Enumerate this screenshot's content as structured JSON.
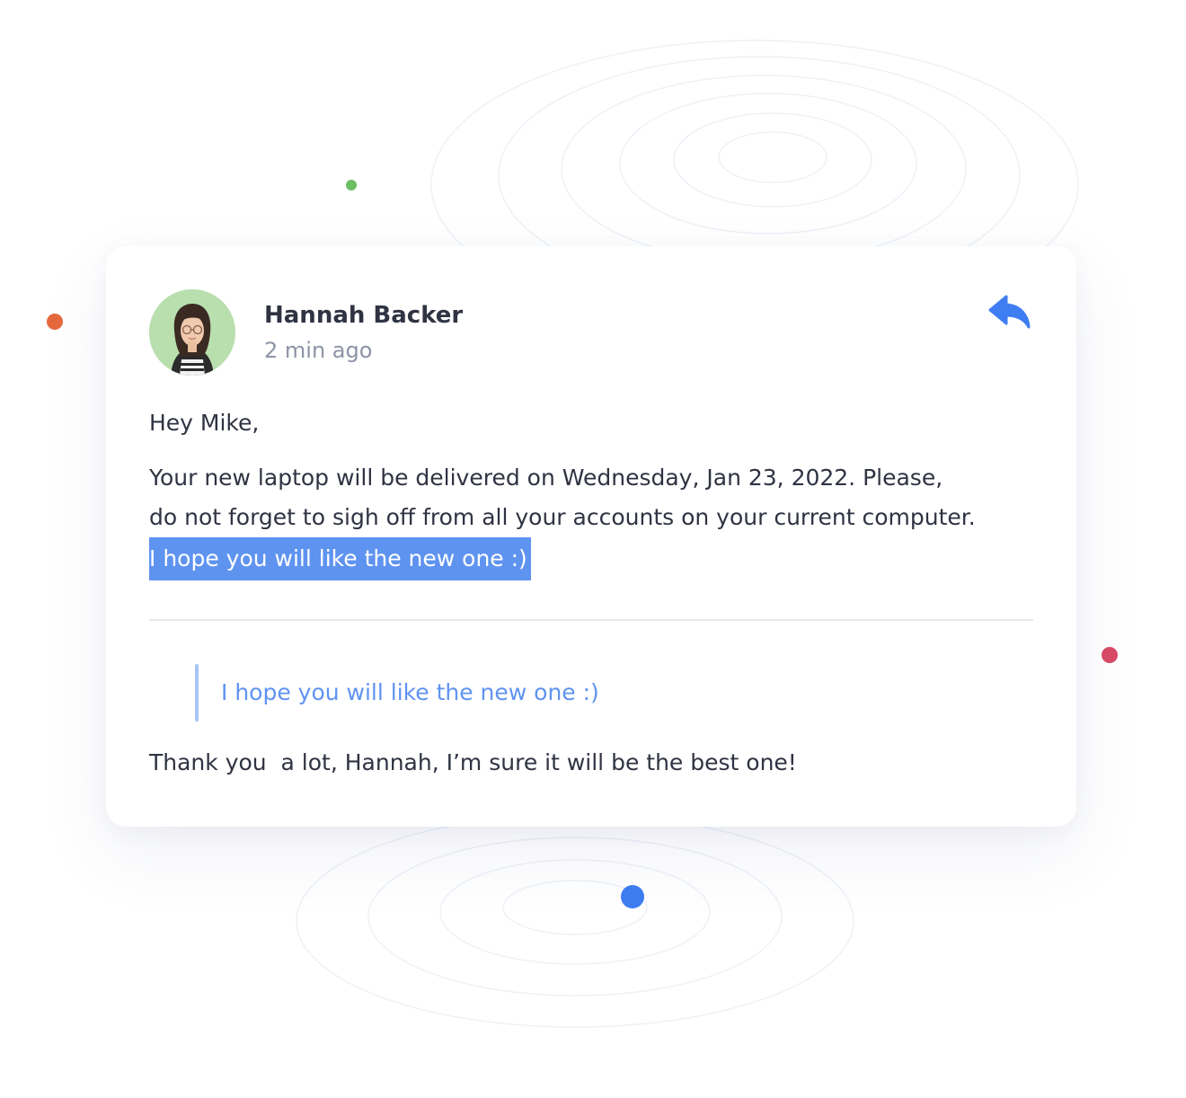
{
  "message": {
    "sender_name": "Hannah Backer",
    "time_ago": "2 min ago",
    "greeting": "Hey Mike,",
    "body_line1": "Your new laptop will be delivered on Wednesday, Jan 23, 2022. Please,",
    "body_line2": "do not forget to sigh off from all your accounts on your current computer.",
    "body_highlight": "I hope you will like the new one :)"
  },
  "reply": {
    "quoted_text": "I hope you will like the new one :)",
    "text": "Thank you  a lot, Hannah, I’m sure it will be the best one!"
  },
  "icons": {
    "reply": "reply-arrow-icon",
    "avatar": "avatar"
  },
  "colors": {
    "accent": "#3f7df2",
    "highlight": "#5f93f0",
    "quote_bar": "#a8c4f6",
    "text": "#2f3342",
    "muted": "#8d93a6",
    "dot_green": "#6dbd63",
    "dot_orange": "#e5693d",
    "dot_pink": "#d94a67",
    "dot_blue": "#3f7df2"
  }
}
